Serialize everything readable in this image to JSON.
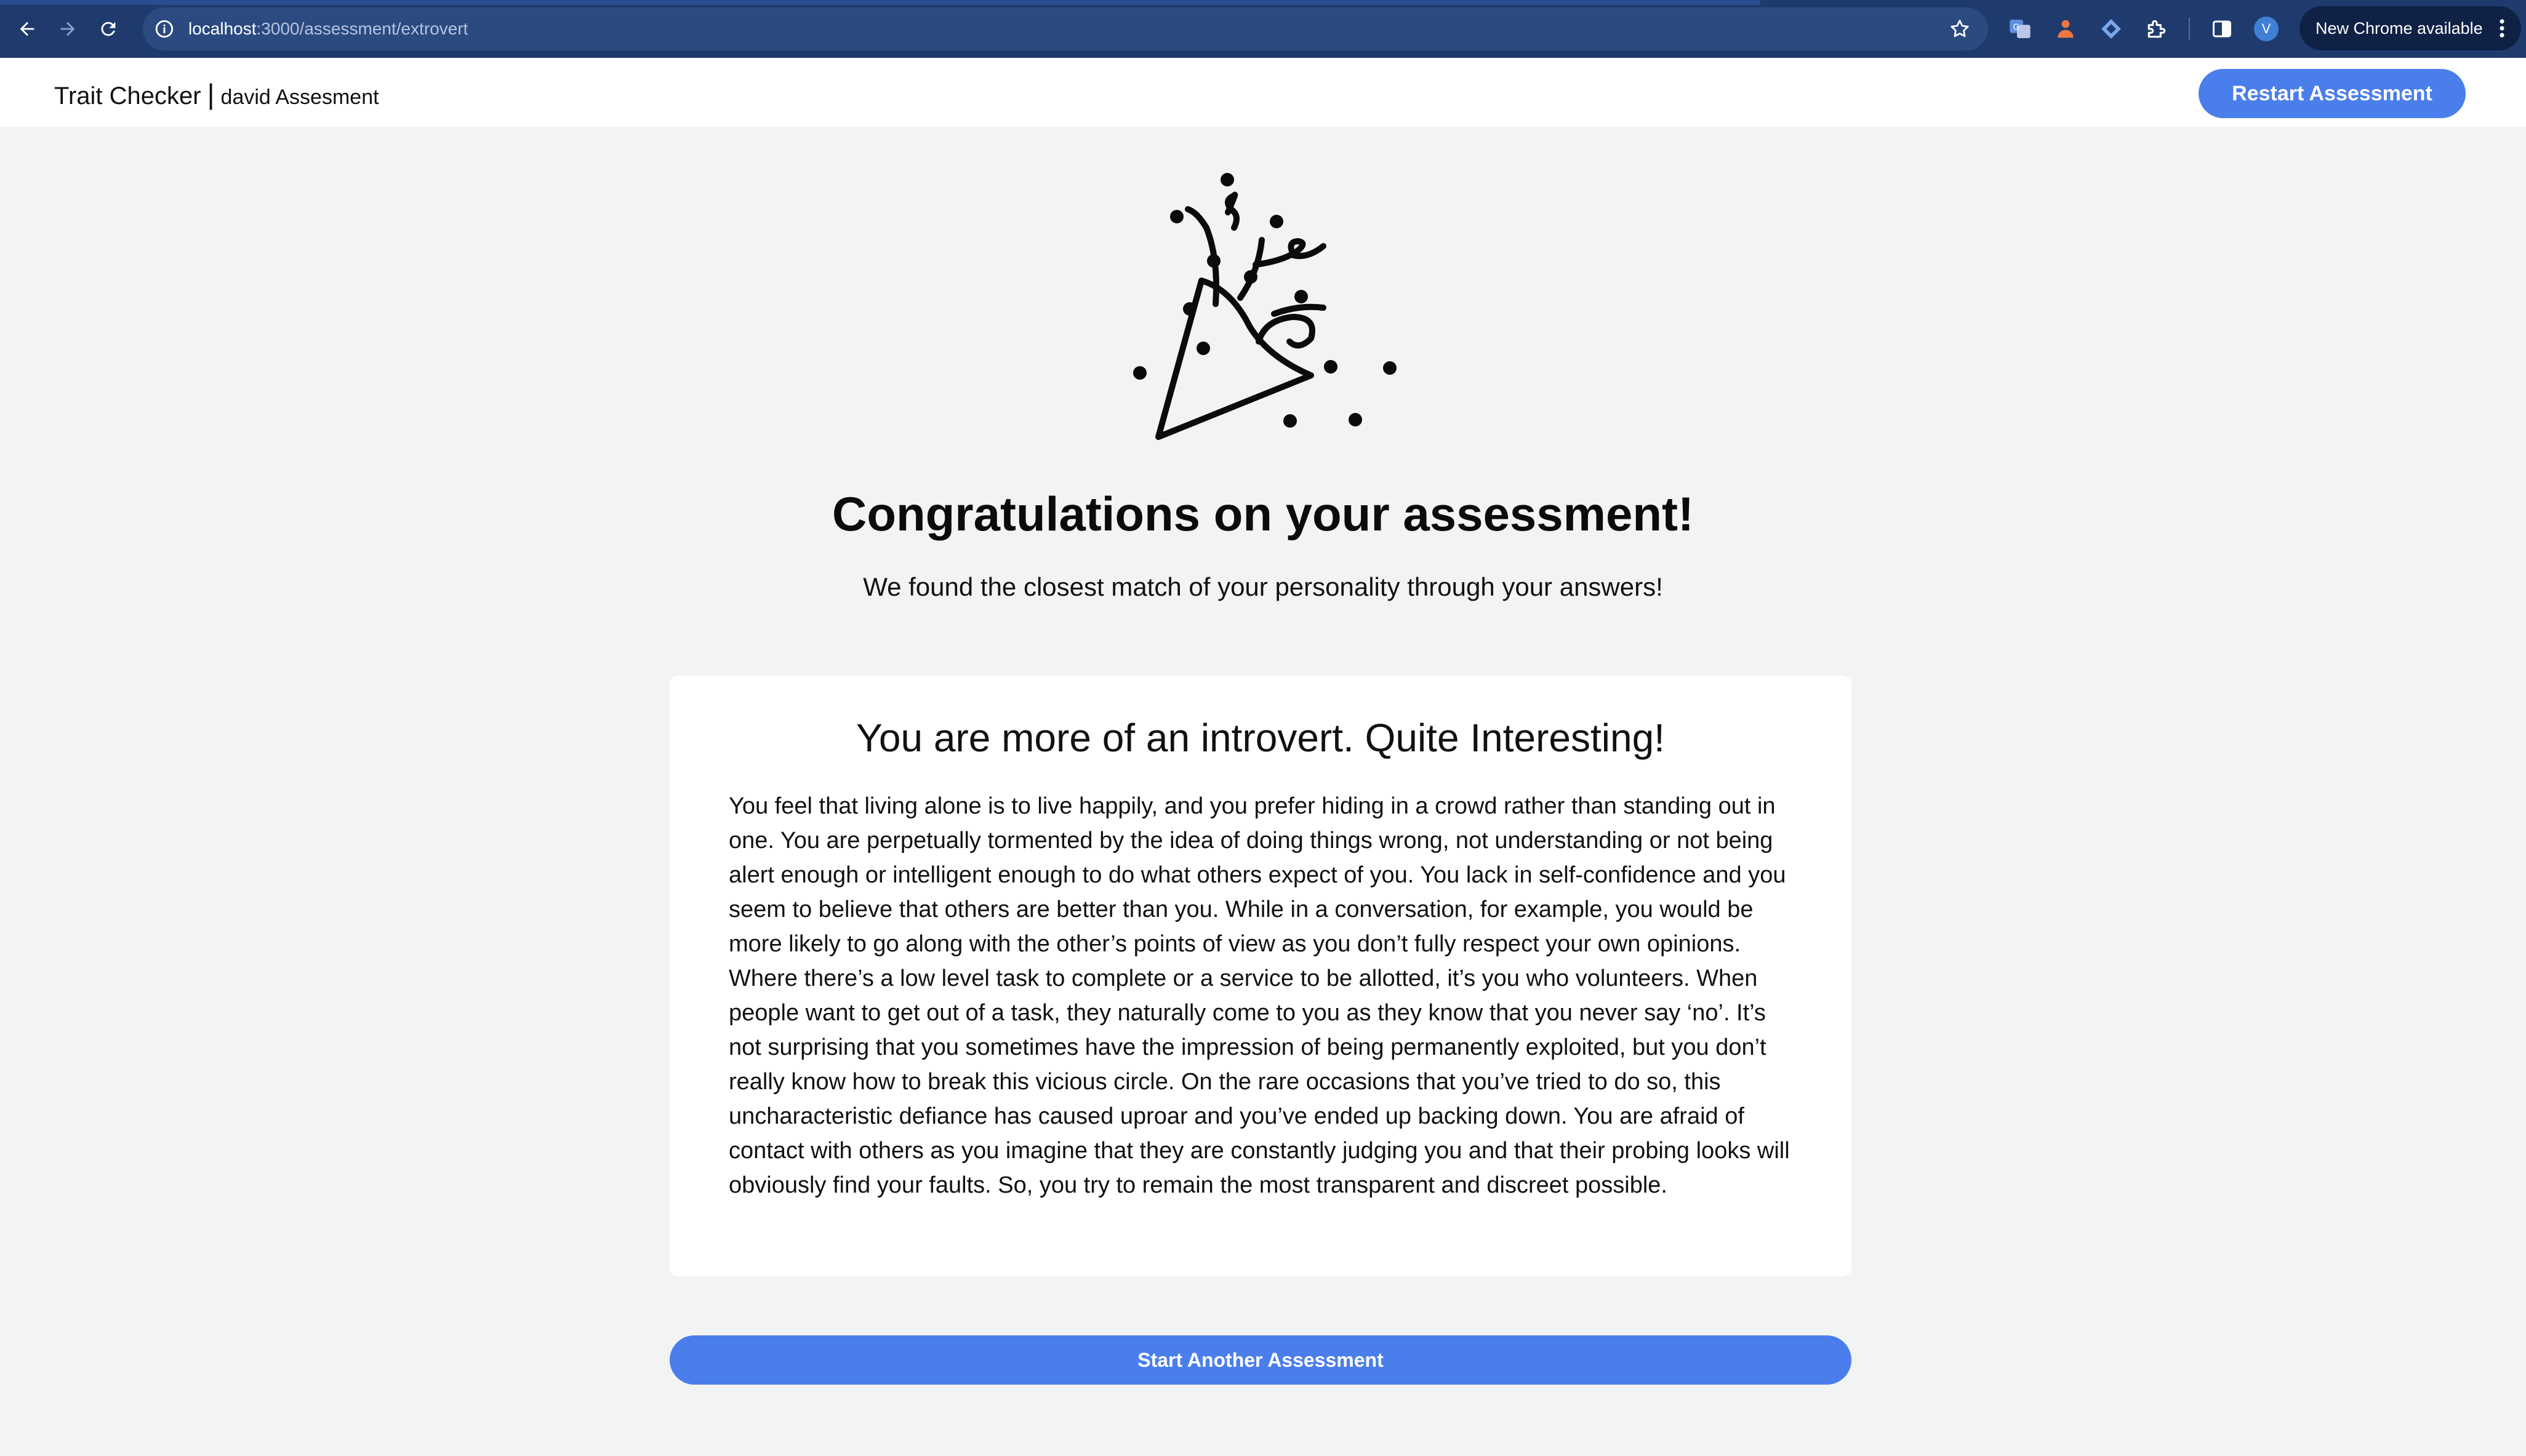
{
  "browser": {
    "url_host": "localhost",
    "url_path": ":3000/assessment/extrovert",
    "avatar_letter": "V",
    "update_label": "New Chrome available",
    "icons": [
      "back-arrow-icon",
      "forward-arrow-icon",
      "reload-icon",
      "site-info-icon",
      "bookmark-star-icon",
      "translate-extension-icon",
      "extension-icon",
      "diamond-extension-icon",
      "puzzle-extensions-icon",
      "side-panel-icon",
      "profile-avatar",
      "more-menu-icon"
    ]
  },
  "header": {
    "brand": "Trait Checker",
    "separator": "|",
    "subtitle": "david Assesment",
    "restart_label": "Restart Assessment"
  },
  "main": {
    "illustration": "party-popper-icon",
    "title": "Congratulations on your assessment!",
    "subtitle": "We found the closest match of your personality through your answers!",
    "result": {
      "title": "You are more of an introvert. Quite Interesting!",
      "body": "You feel that living alone is to live happily, and you prefer hiding in a crowd rather than standing out in one. You are perpetually tormented by the idea of doing things wrong, not understanding or not being alert enough or intelligent enough to do what others expect of you. You lack in self-confidence and you seem to believe that others are better than you. While in a conversation, for example, you would be more likely to go along with the other’s points of view as you don’t fully respect your own opinions. Where there’s a low level task to complete or a service to be allotted, it’s you who volunteers. When people want to get out of a task, they naturally come to you as they know that you never say ‘no’. It’s not surprising that you sometimes have the impression of being permanently exploited, but you don’t really know how to break this vicious circle. On the rare occasions that you’ve tried to do so, this uncharacteristic defiance has caused uproar and you’ve ended up backing down. You are afraid of contact with others as you imagine that they are constantly judging you and that their probing looks will obviously find your faults. So, you try to remain the most transparent and discreet possible."
    },
    "another_label": "Start Another Assessment"
  },
  "colors": {
    "browser_bar": "#1f3b6e",
    "omnibox": "#2b4a80",
    "accent_button": "#4a7eea",
    "page_background": "#f2f3f5",
    "card_background": "#ffffff"
  }
}
